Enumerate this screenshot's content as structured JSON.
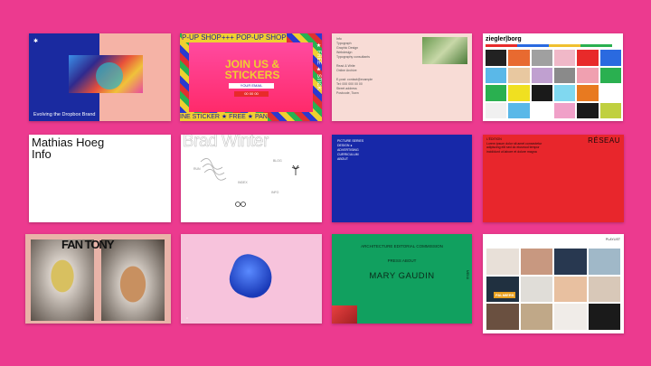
{
  "cards": {
    "c1": {
      "logo": "✱",
      "caption": "Evolving the Dropbox Brand"
    },
    "c2": {
      "head": "P-UP SHOP+++ POP-UP SHOP",
      "big": "JOIN US & STICKERS",
      "email": "YOUR EMAIL",
      "btn": "00 00 00",
      "foot": "INE STICKER ★ FREE ★ PAN",
      "side": "★ FREE ★ STICK"
    },
    "c3": {
      "lines": [
        "Info",
        "Typograph",
        "Graphic Design",
        "Webdesign",
        "Typography consultants",
        "",
        "Read & Write",
        "Online Archive",
        "",
        "E-post: contact@example",
        "Tel: 000 000 00 00",
        "Street address",
        "Postcode, Town"
      ]
    },
    "c4": {
      "logo": "ziegler|borg",
      "swatches": [
        "#222222",
        "#e86a30",
        "#a0a0a0",
        "#f0b8c8",
        "#e82a2a",
        "#2a6ae0",
        "#5ab8e8",
        "#e8c8a0",
        "#c0a0d0",
        "#8a8a8a",
        "#f0a0b0",
        "#2ab050",
        "#2ab050",
        "#f0e020",
        "#1a1a1a",
        "#80d8f0",
        "#e87a20",
        "#ffffff",
        "#f0f0f0",
        "#5ab8e8",
        "#ffffff",
        "#f0a0c8",
        "#1a1a1a",
        "#c0d040"
      ]
    },
    "c5": {
      "name_line1": "Mathias Hoeg",
      "name_line2": "Info"
    },
    "c6": {
      "name": "Brad Winter",
      "l1": "RUN",
      "l2": "BLOG",
      "l3": "INDEX",
      "l4": "INFO"
    },
    "c7": {
      "menu": [
        "PICTURE  SERIES",
        "DESIGN  ●",
        "ADVERTISING",
        "CURRICULUM",
        "ABOUT"
      ]
    },
    "c8": {
      "logo": "RÉSEAU",
      "text": [
        "L'ÉDITION",
        "Lorem ipsum dolor sit amet consectetur",
        "adipiscing elit sed do eiusmod tempor",
        "incididunt ut labore et dolore magna"
      ]
    },
    "c9": {
      "title": "FAN TONY"
    },
    "c10": {
      "tl": "·",
      "tr": "· · ·",
      "bl": "□"
    },
    "c11": {
      "nav": "ARCHITECTURE    EDITORIAL    COMMISSION",
      "sub": "PRESS       ABOUT",
      "title": "MARY GAUDIN",
      "side": "MENU"
    },
    "c12": {
      "hdr": "PLAYLIST",
      "badge": "PALMIERS",
      "tiles": [
        "#e8e0d8",
        "#c89880",
        "#283850",
        "#a0b8c8",
        "#203040",
        "#e0ddd8",
        "#e8c0a0",
        "#d8c8b8",
        "#6a5040",
        "#c0a888",
        "#f0ece8",
        "#1a1a1a"
      ]
    }
  }
}
